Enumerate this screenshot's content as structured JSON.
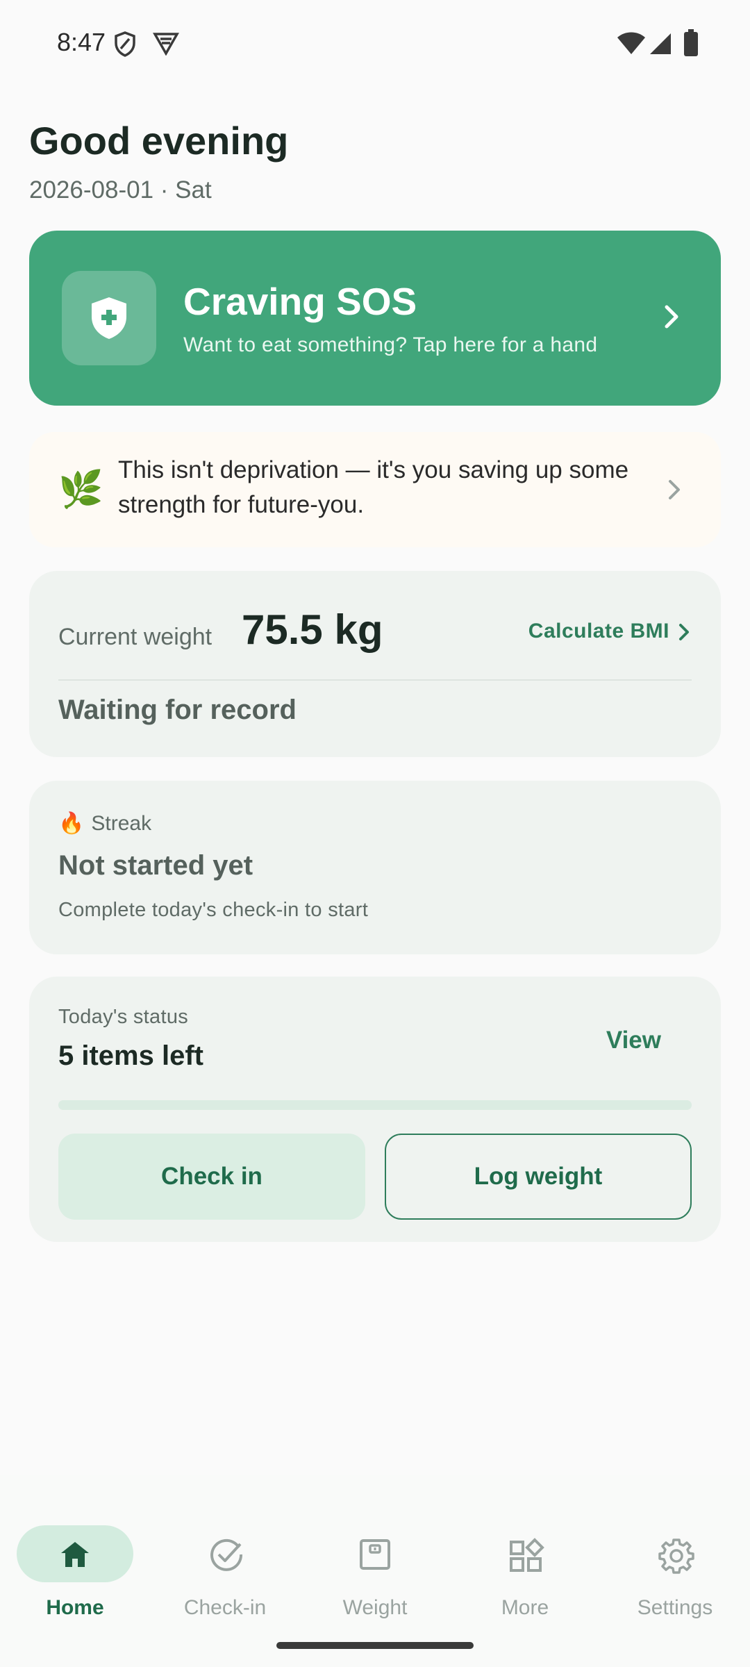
{
  "status_bar": {
    "time": "8:47",
    "icons": [
      "shield-outline-icon",
      "vpn-badge-icon",
      "wifi-icon",
      "cellular-signal-icon",
      "battery-icon"
    ]
  },
  "header": {
    "greeting": "Good evening",
    "date": "2026-08-01 · Sat"
  },
  "sos_card": {
    "title": "Craving SOS",
    "subtitle": "Want to eat something? Tap here for a hand",
    "icon": "shield-plus-icon",
    "color": "#41a67b"
  },
  "quote_card": {
    "icon": "🌿",
    "text": "This isn't deprivation — it's you saving up some strength for future-you."
  },
  "weight_card": {
    "label": "Current weight",
    "value": "75.5 kg",
    "bmi_link": "Calculate BMI",
    "status": "Waiting for record"
  },
  "streak_card": {
    "icon": "🔥",
    "label": "Streak",
    "title": "Not started yet",
    "subtitle": "Complete today's check-in to start"
  },
  "status_card": {
    "label": "Today's status",
    "value": "5 items left",
    "view_link": "View",
    "progress": 0,
    "check_in_button": "Check in",
    "log_weight_button": "Log weight"
  },
  "bottom_nav": {
    "items": [
      {
        "label": "Home",
        "icon": "home-icon",
        "active": true
      },
      {
        "label": "Check-in",
        "icon": "check-circle-icon",
        "active": false
      },
      {
        "label": "Weight",
        "icon": "scale-icon",
        "active": false
      },
      {
        "label": "More",
        "icon": "grid-icon",
        "active": false
      },
      {
        "label": "Settings",
        "icon": "gear-icon",
        "active": false
      }
    ]
  },
  "colors": {
    "accent": "#41a67b",
    "accent_dark": "#2e7d5b",
    "background": "#fafafa",
    "panel": "#eff3f0"
  }
}
